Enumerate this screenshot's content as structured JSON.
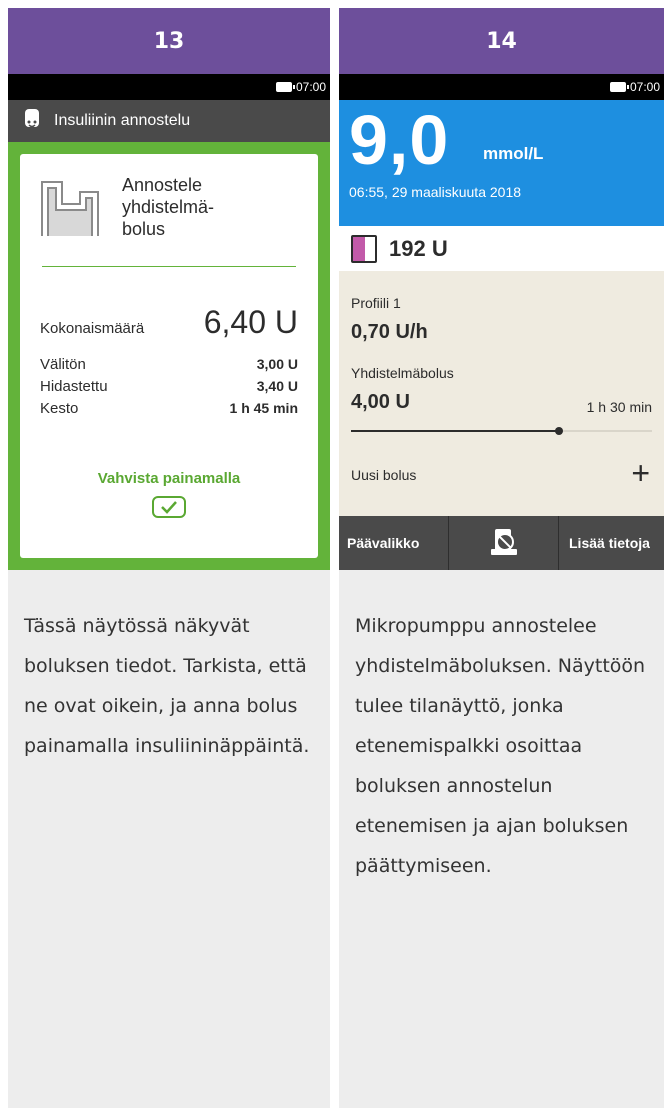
{
  "colors": {
    "header_purple": "#6d4f9b",
    "confirm_green": "#63b33a",
    "glucose_blue": "#1e8fe0",
    "status_beige": "#efebe0",
    "reservoir_pink": "#c25aa9"
  },
  "panels": [
    {
      "step": "13",
      "clock": "07:00",
      "screen_title": "Insuliinin annostelu",
      "screen_icon": "pump-icon",
      "card": {
        "heading": "Annostele\nyhdistelmä-\nbolus",
        "icon": "multiwave-bolus-icon",
        "total_label": "Kokonaismäärä",
        "total_value": "6,40 U",
        "rows": [
          {
            "label": "Välitön",
            "value": "3,00 U"
          },
          {
            "label": "Hidastettu",
            "value": "3,40 U"
          },
          {
            "label": "Kesto",
            "value": "1 h 45 min"
          }
        ],
        "confirm_text": "Vahvista painamalla",
        "confirm_icon": "check-icon"
      },
      "description": "Tässä näytössä näkyvät boluksen tiedot. Tarkista, että ne ovat oikein, ja anna bolus painamalla insuliininäppäintä."
    },
    {
      "step": "14",
      "clock": "07:00",
      "glucose": {
        "value": "9,0",
        "unit": "mmol/L",
        "timestamp": "06:55, 29 maaliskuuta 2018"
      },
      "reservoir": {
        "value": "192 U",
        "icon": "reservoir-icon"
      },
      "status": {
        "profile": "Profiili 1",
        "basal_rate": "0,70 U/h",
        "bolus_type": "Yhdistelmäbolus",
        "bolus_amount": "4,00 U",
        "remaining": "1 h 30 min",
        "progress_fraction": 0.69,
        "new_bolus": "Uusi bolus"
      },
      "bottom_bar": {
        "left": "Päävalikko",
        "middle_icon": "stop-pump-icon",
        "right": "Lisää tietoja"
      },
      "description": "Mikropumppu annostelee yhdistelmäboluksen. Näyttöön tulee tilanäyttö, jonka etenemispalkki osoittaa boluksen annostelun etenemisen ja ajan boluksen päättymiseen."
    }
  ]
}
